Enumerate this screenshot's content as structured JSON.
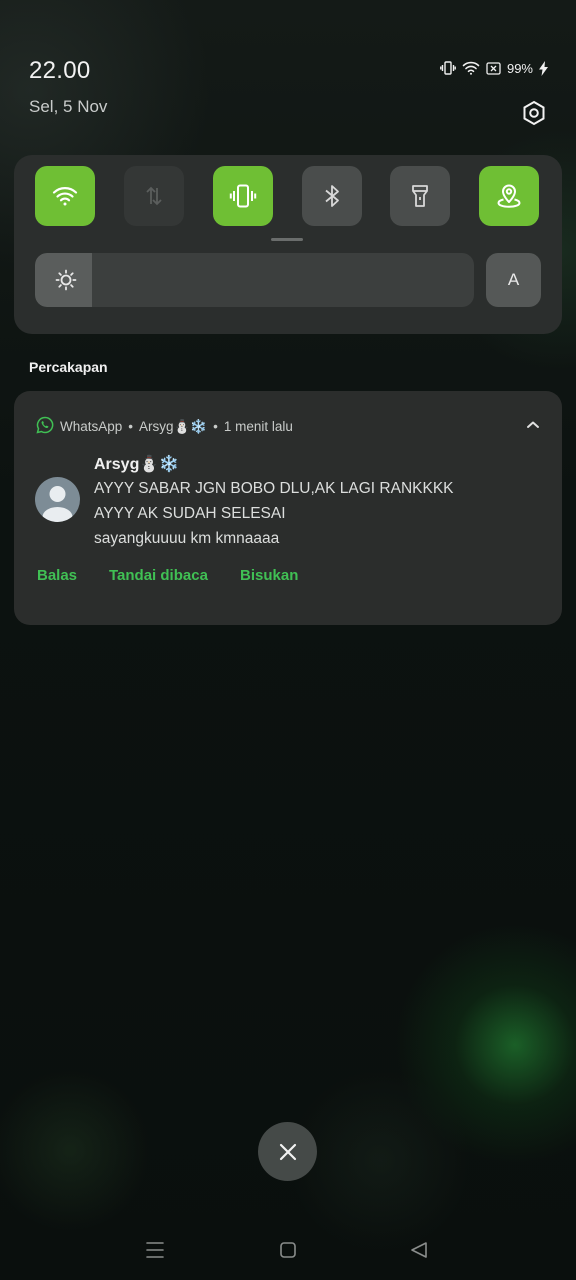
{
  "status_bar": {
    "time": "22.00",
    "date": "Sel, 5 Nov",
    "battery": "99%",
    "icons": [
      "vibrate-icon",
      "wifi-icon",
      "sim-off-icon",
      "battery-icon",
      "charging-icon"
    ]
  },
  "quick_settings": {
    "tiles": [
      {
        "name": "wifi-toggle",
        "icon": "wifi-icon",
        "state": "on"
      },
      {
        "name": "mobile-data-toggle",
        "icon": "data-arrows-icon",
        "state": "disabled"
      },
      {
        "name": "vibrate-toggle",
        "icon": "vibrate-icon",
        "state": "on"
      },
      {
        "name": "bluetooth-toggle",
        "icon": "bluetooth-icon",
        "state": "off"
      },
      {
        "name": "flashlight-toggle",
        "icon": "flashlight-icon",
        "state": "off"
      },
      {
        "name": "location-toggle",
        "icon": "location-icon",
        "state": "on"
      }
    ],
    "brightness_level": 0.13,
    "auto_label": "A"
  },
  "section_title": "Percakapan",
  "notification": {
    "app": "WhatsApp",
    "sender_short": "Arsyg⛄❄️",
    "time_ago": "1 menit lalu",
    "sender": "Arsyg⛄❄️",
    "messages": [
      "AYYY SABAR JGN BOBO DLU,AK LAGI RANKKKK",
      "AYYY AK SUDAH SELESAI",
      "sayangkuuuu km kmnaaaa"
    ],
    "actions": {
      "reply": "Balas",
      "mark_read": "Tandai dibaca",
      "mute": "Bisukan"
    }
  },
  "colors": {
    "accent_green": "#6fbf34",
    "action_green": "#40c054",
    "panel": "#2b2e2d"
  }
}
